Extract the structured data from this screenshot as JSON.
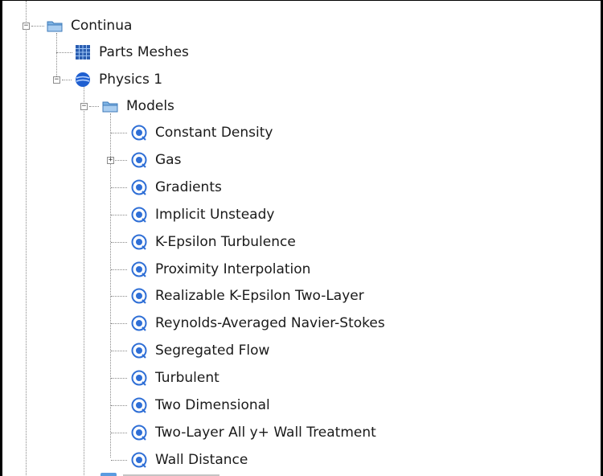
{
  "tree": {
    "continua": {
      "label": "Continua",
      "icon": "folder-icon",
      "expanded": true
    },
    "parts_meshes": {
      "label": "Parts Meshes",
      "icon": "mesh-grid-icon"
    },
    "physics": {
      "label": "Physics 1",
      "icon": "physics-sphere-icon",
      "expanded": true
    },
    "models": {
      "label": "Models",
      "icon": "folder-icon",
      "expanded": true,
      "items": [
        {
          "label": "Constant Density",
          "icon": "model-icon"
        },
        {
          "label": "Gas",
          "icon": "model-icon",
          "expandable": true
        },
        {
          "label": "Gradients",
          "icon": "model-icon"
        },
        {
          "label": "Implicit Unsteady",
          "icon": "model-icon"
        },
        {
          "label": "K-Epsilon Turbulence",
          "icon": "model-icon"
        },
        {
          "label": "Proximity Interpolation",
          "icon": "model-icon"
        },
        {
          "label": "Realizable K-Epsilon Two-Layer",
          "icon": "model-icon"
        },
        {
          "label": "Reynolds-Averaged Navier-Stokes",
          "icon": "model-icon"
        },
        {
          "label": "Segregated Flow",
          "icon": "model-icon"
        },
        {
          "label": "Turbulent",
          "icon": "model-icon"
        },
        {
          "label": "Two Dimensional",
          "icon": "model-icon"
        },
        {
          "label": "Two-Layer All y+ Wall Treatment",
          "icon": "model-icon"
        },
        {
          "label": "Wall Distance",
          "icon": "model-icon"
        }
      ]
    }
  },
  "colors": {
    "folder": "#6fa8dc",
    "model": "#2f6fd6",
    "mesh": "#2a5db0",
    "connector": "#8a8a8a"
  }
}
